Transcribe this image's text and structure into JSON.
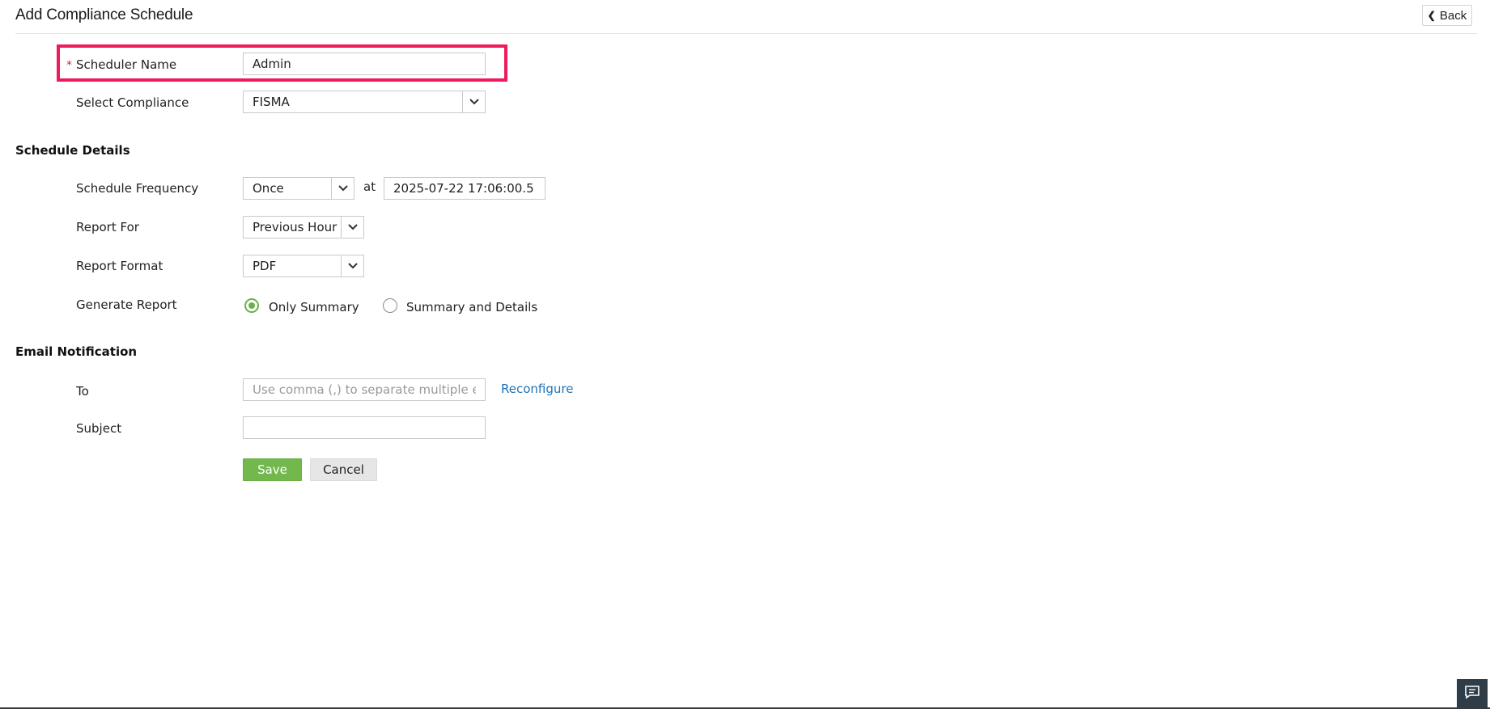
{
  "header": {
    "title": "Add Compliance Schedule",
    "back_label": "Back"
  },
  "form": {
    "scheduler_name": {
      "required_mark": "*",
      "label": "Scheduler Name",
      "value": "Admin"
    },
    "compliance": {
      "label": "Select Compliance",
      "value": "FISMA"
    }
  },
  "schedule_details": {
    "title": "Schedule Details",
    "frequency": {
      "label": "Schedule Frequency",
      "value": "Once",
      "at_label": "at",
      "datetime": "2025-07-22 17:06:00.5"
    },
    "report_for": {
      "label": "Report For",
      "value": "Previous Hour"
    },
    "report_format": {
      "label": "Report Format",
      "value": "PDF"
    },
    "generate_report": {
      "label": "Generate Report",
      "options": [
        {
          "label": "Only Summary",
          "checked": true
        },
        {
          "label": "Summary and Details",
          "checked": false
        }
      ]
    }
  },
  "email_notification": {
    "title": "Email Notification",
    "to": {
      "label": "To",
      "placeholder": "Use comma (,) to separate multiple emails",
      "value": ""
    },
    "reconfigure_label": "Reconfigure",
    "subject": {
      "label": "Subject",
      "value": ""
    }
  },
  "actions": {
    "save_label": "Save",
    "cancel_label": "Cancel"
  },
  "colors": {
    "highlight": "#ee1b5b",
    "save_green": "#72b84d",
    "link_blue": "#1f73b7",
    "radio_green": "#6ab04c"
  },
  "icons": {
    "back": "chevron-left-icon",
    "dropdown": "chevron-down-icon",
    "chat": "chat-icon"
  }
}
